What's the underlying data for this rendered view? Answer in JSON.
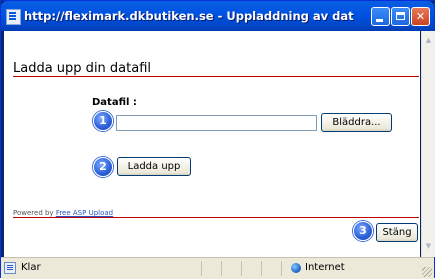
{
  "window": {
    "title": "http://fleximark.dkbutiken.se - Uppladdning av datafil - Micros...",
    "controls": {
      "minimize_icon": "minimize-icon",
      "maximize_icon": "maximize-icon",
      "close_glyph": "✕"
    }
  },
  "page": {
    "title": "Ladda upp din datafil",
    "file_label": "Datafil :",
    "file_value": "",
    "browse_label": "Bläddra...",
    "upload_label": "Ladda upp",
    "close_label": "Stäng",
    "powered_prefix": "Powered by",
    "powered_link": "Free ASP Upload",
    "steps": [
      "1",
      "2",
      "3"
    ]
  },
  "scrollbar": {
    "up_glyph": "▲",
    "down_glyph": "▼"
  },
  "status": {
    "text": "Klar",
    "zone": "Internet"
  },
  "colors": {
    "titlebar": "#0054e3",
    "rule": "#c00000",
    "badge": "#2a5fd8",
    "statusbar": "#ece9d8"
  }
}
